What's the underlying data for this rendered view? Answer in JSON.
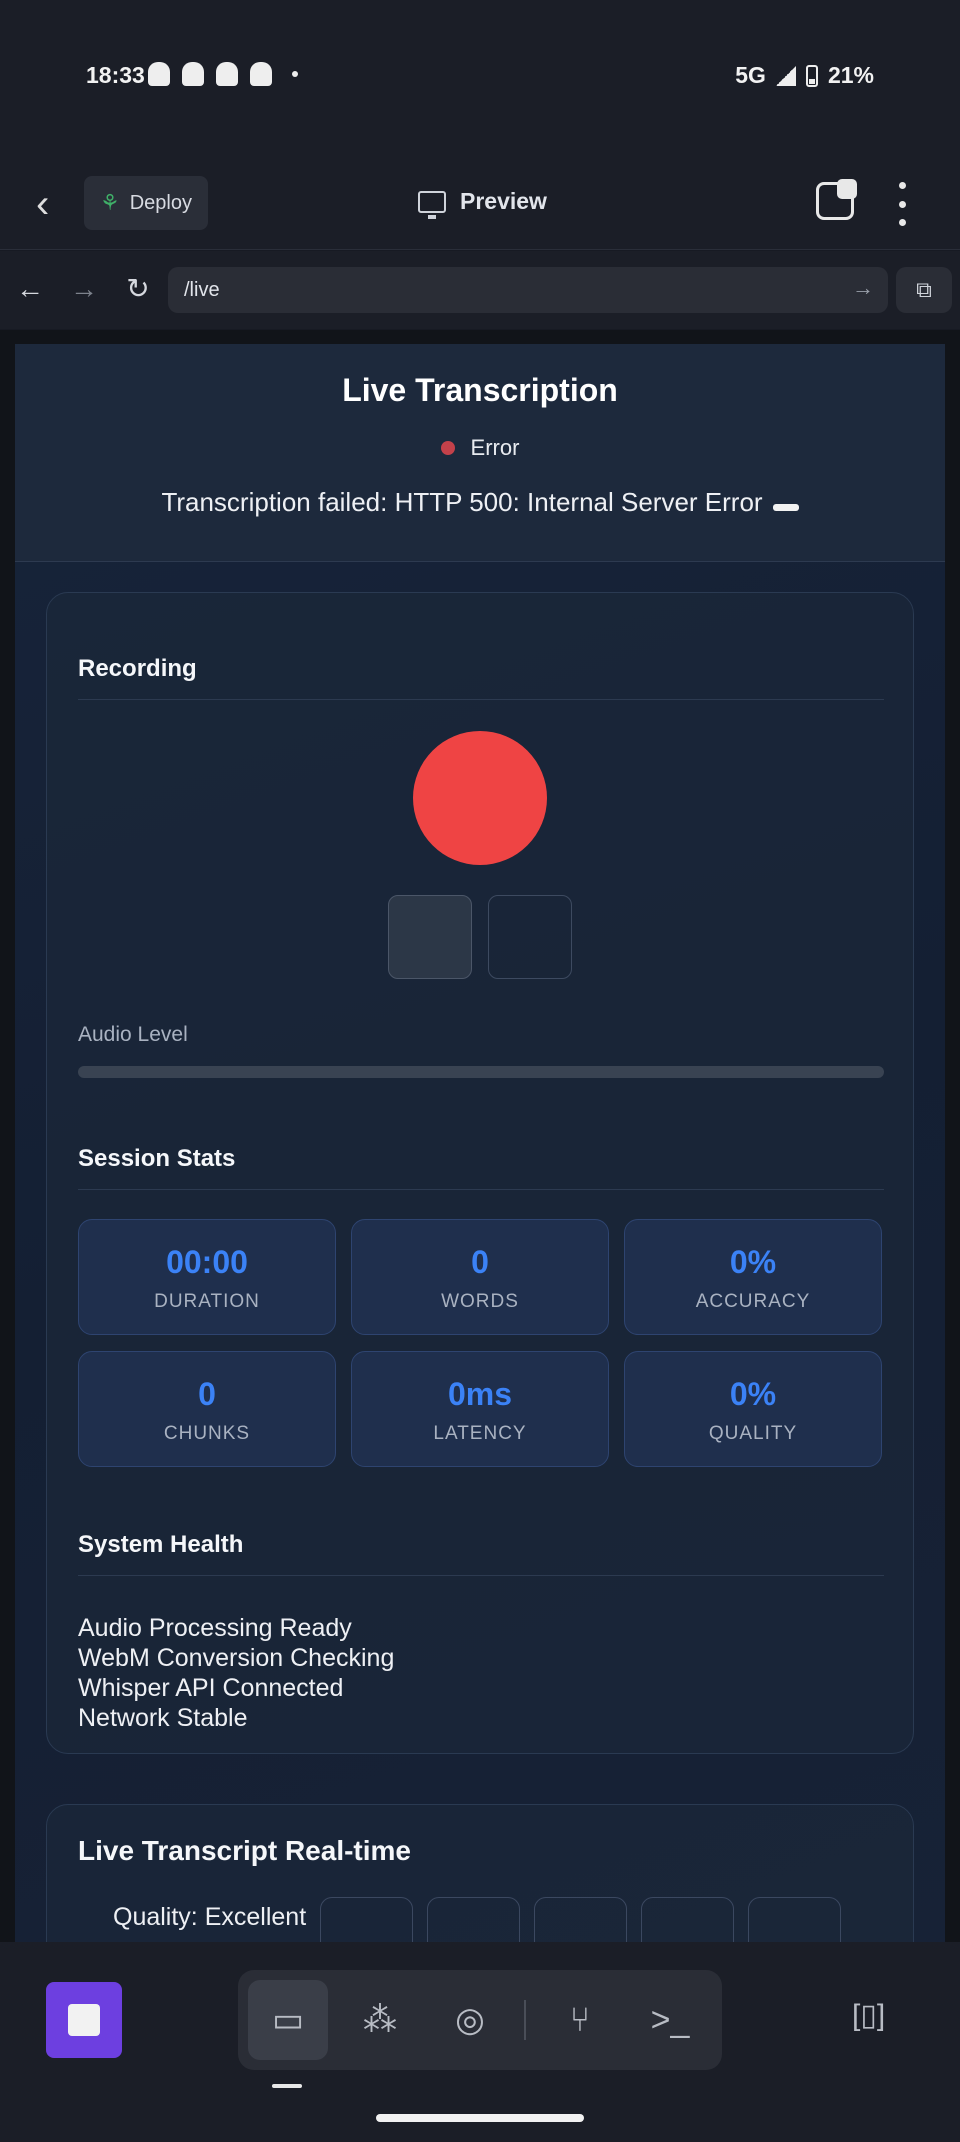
{
  "status_bar": {
    "time": "18:33",
    "network": "5G",
    "battery": "21%"
  },
  "app_toolbar": {
    "deploy_label": "Deploy",
    "preview_label": "Preview"
  },
  "browser": {
    "url": "/live"
  },
  "page": {
    "title": "Live Transcription",
    "status": "Error",
    "status_color": "#c4414a",
    "error_message": "Transcription failed: HTTP 500: Internal Server Error",
    "recording": {
      "section_title": "Recording",
      "record_button_color": "#ef4444",
      "audio_level_label": "Audio Level",
      "audio_level": 0
    },
    "session_stats": {
      "section_title": "Session Stats",
      "stats": [
        {
          "value": "00:00",
          "label": "DURATION"
        },
        {
          "value": "0",
          "label": "WORDS"
        },
        {
          "value": "0%",
          "label": "ACCURACY"
        },
        {
          "value": "0",
          "label": "CHUNKS"
        },
        {
          "value": "0ms",
          "label": "LATENCY"
        },
        {
          "value": "0%",
          "label": "QUALITY"
        }
      ]
    },
    "system_health": {
      "section_title": "System Health",
      "items": [
        "Audio Processing Ready",
        "WebM Conversion Checking",
        "Whisper API Connected",
        "Network Stable"
      ]
    },
    "live_transcript": {
      "section_title": "Live Transcript Real-time",
      "quality_label": "Quality: Excellent"
    }
  },
  "bottom_nav": {
    "items": [
      "desktop-icon",
      "grid-icon",
      "globe-icon",
      "branch-icon",
      "terminal-icon"
    ],
    "active_index": 0
  },
  "colors": {
    "accent": "#3b82f6",
    "stop_button": "#6d3fe0"
  }
}
